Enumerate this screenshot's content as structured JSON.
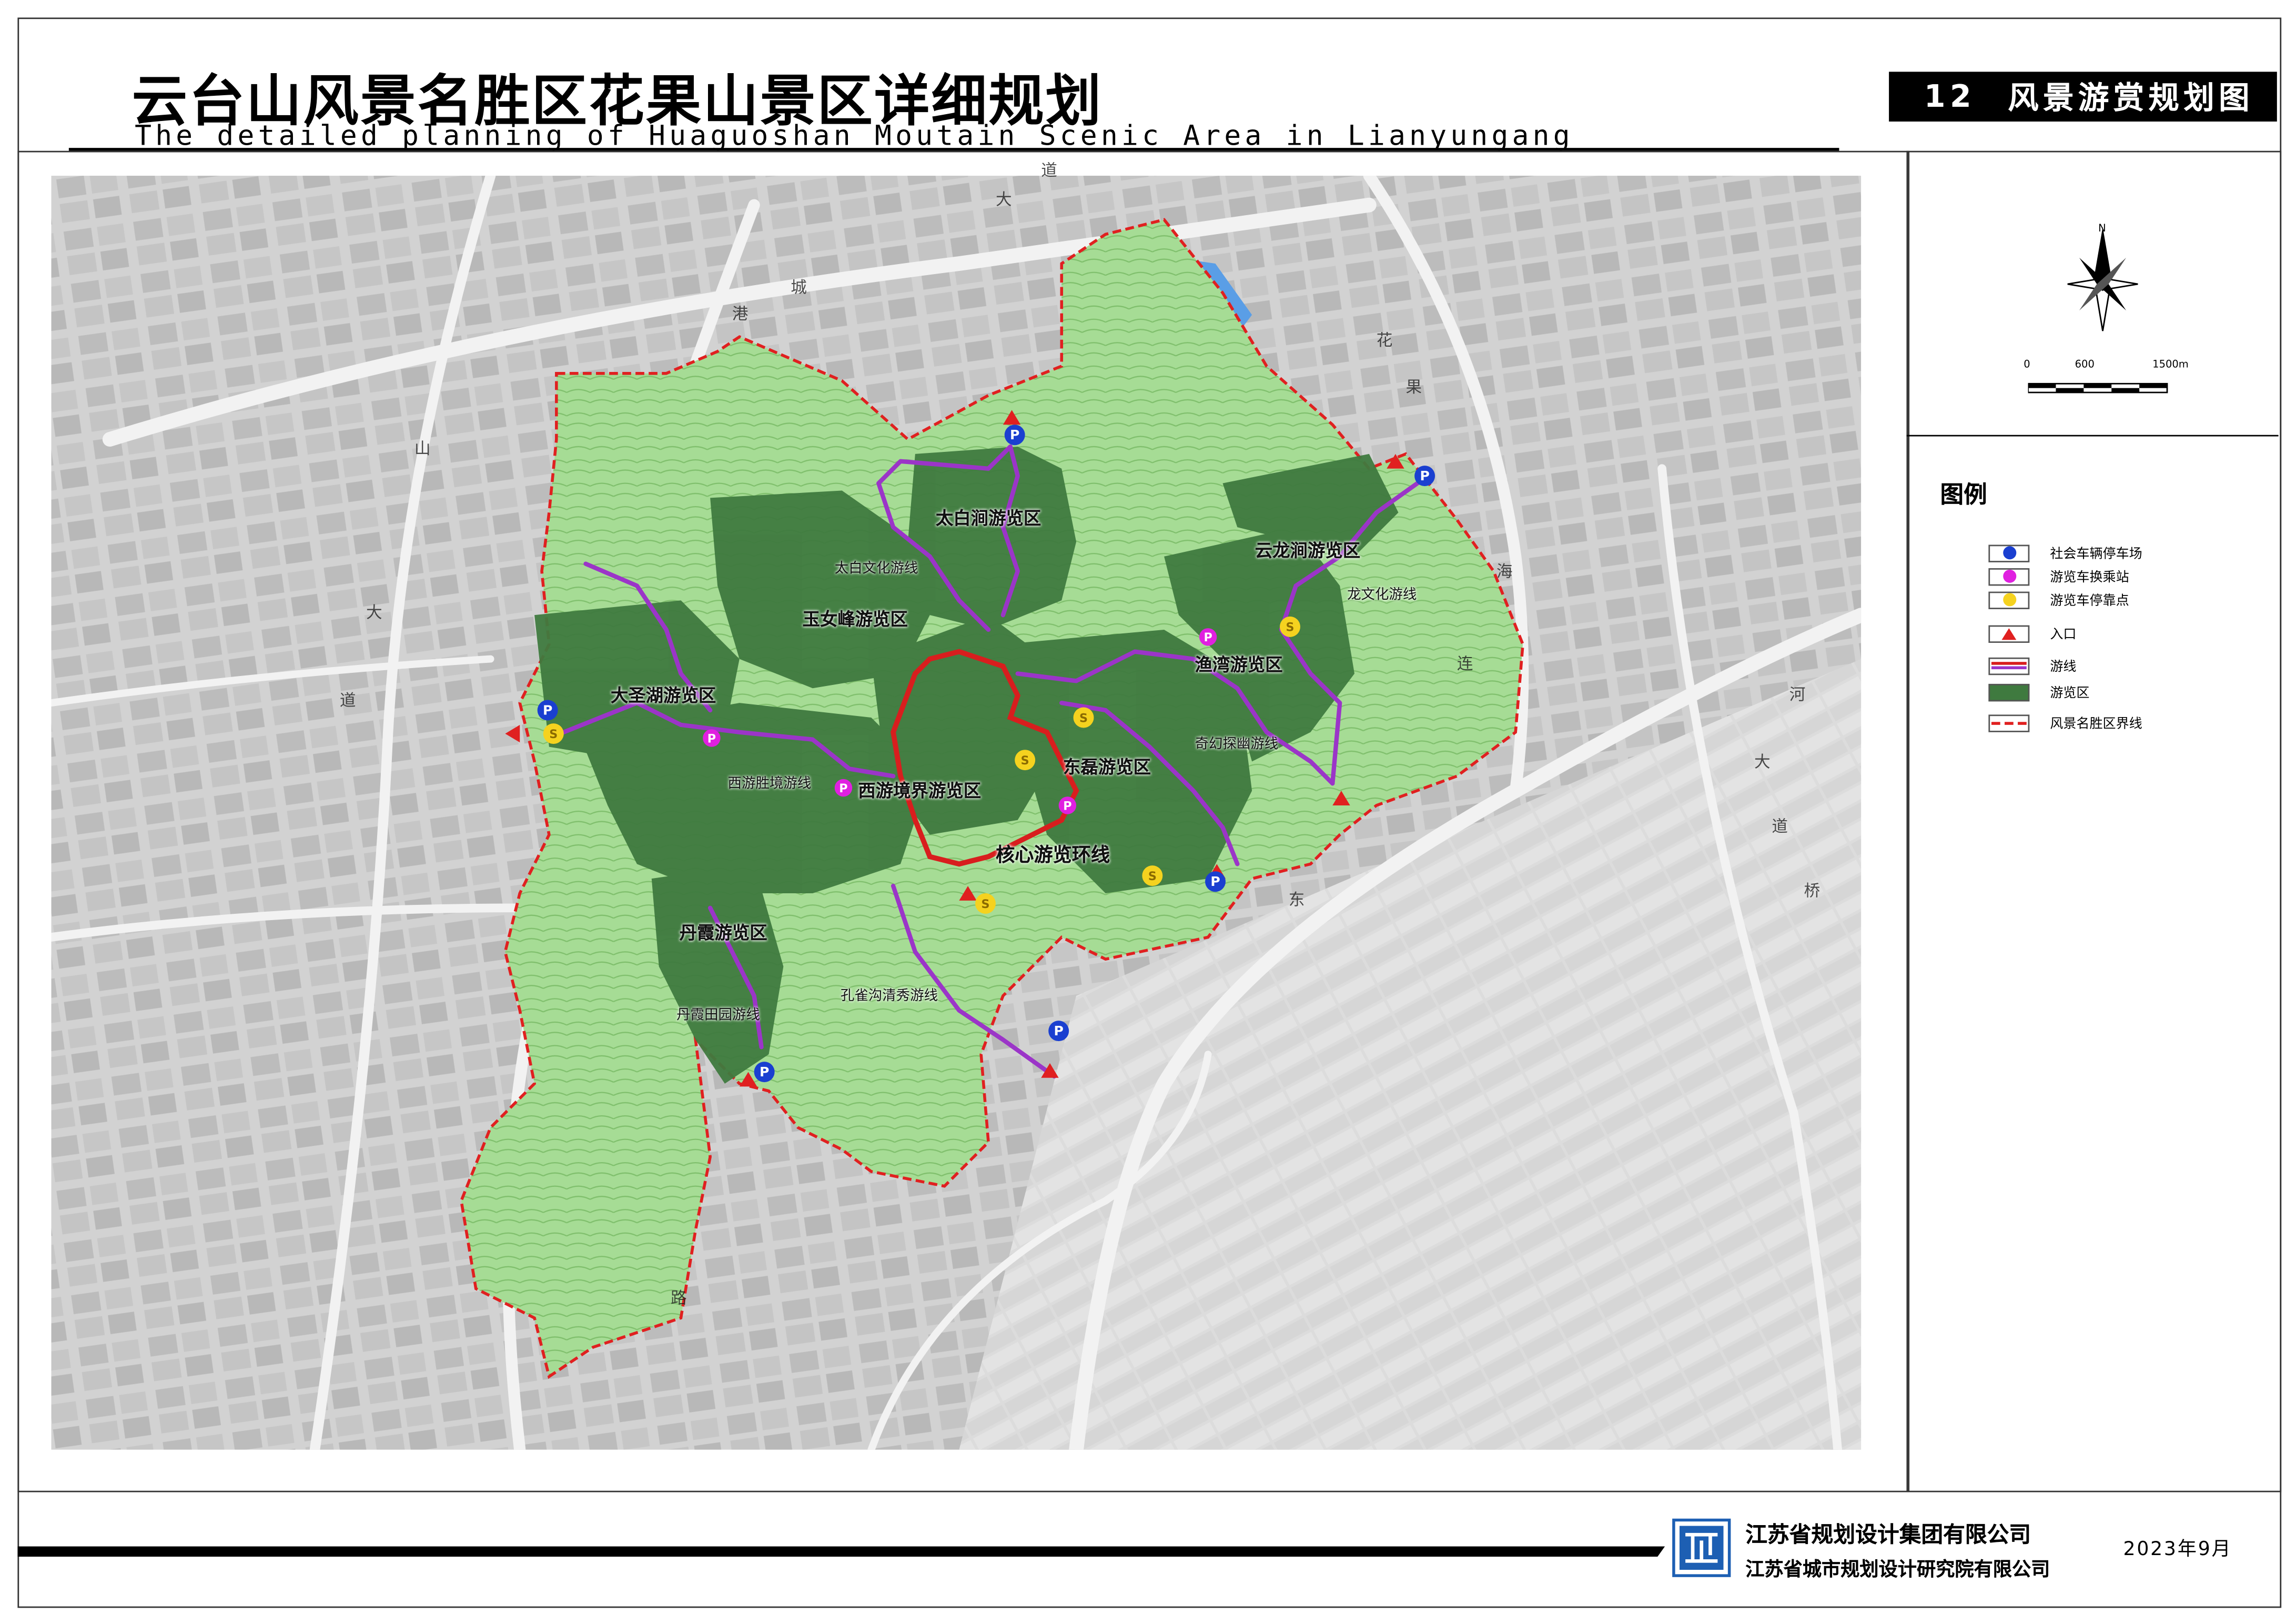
{
  "header": {
    "title_cn": "云台山风景名胜区花果山景区详细规划",
    "title_en": "The detailed planning of Huaguoshan Moutain Scenic Area in Lianyungang",
    "sheet_number": "12",
    "sheet_title": "风景游赏规划图"
  },
  "compass": {
    "north_label": "N"
  },
  "scale_bar": {
    "labels": [
      "0",
      "600",
      "1500m"
    ]
  },
  "legend": {
    "title": "图例",
    "items": [
      {
        "label": "社会车辆停车场",
        "symbol": "parking-icon",
        "color": "#1a3fd0"
      },
      {
        "label": "游览车换乘站",
        "symbol": "transfer-station-icon",
        "color": "#e020e0"
      },
      {
        "label": "游览车停靠点",
        "symbol": "stop-point-icon",
        "color": "#f5d21f"
      },
      {
        "label": "入口",
        "symbol": "entrance-triangle-icon",
        "color": "#e02020"
      },
      {
        "label": "游线",
        "symbol": "tour-route-line",
        "color": "#9b35c8"
      },
      {
        "label": "游览区",
        "symbol": "tour-area-fill",
        "color": "#3f7a3f"
      },
      {
        "label": "风景名胜区界线",
        "symbol": "boundary-dashed-line",
        "color": "#e02020"
      }
    ]
  },
  "map": {
    "area_labels": [
      "太白涧游览区",
      "玉女峰游览区",
      "大圣湖游览区",
      "西游境界游览区",
      "东磊游览区",
      "渔湾游览区",
      "云龙涧游览区",
      "丹霞游览区"
    ],
    "route_labels": [
      "太白文化游线",
      "西游胜境游线",
      "核心游览环线",
      "龙文化游线",
      "奇幻探幽游线",
      "丹霞田园游线",
      "孔雀沟清秀游线"
    ],
    "road_labels": [
      "港",
      "城",
      "大",
      "道",
      "花",
      "果",
      "山",
      "大",
      "道",
      "海",
      "连",
      "东",
      "路",
      "大",
      "道",
      "河",
      "桥"
    ],
    "parking_glyph": "P",
    "stop_glyph": "S",
    "colors": {
      "core_loop": "#d81e1e",
      "route": "#9b35c8",
      "tour_area": "#3f7a3f",
      "mountain": "#9fd88f",
      "boundary": "#e02020",
      "water": "#5a9ee6",
      "city_background": "#cfcfcf"
    }
  },
  "footer": {
    "company_1": "江苏省规划设计集团有限公司",
    "company_2": "江苏省城市规划设计研究院有限公司",
    "date": "2023年9月"
  }
}
